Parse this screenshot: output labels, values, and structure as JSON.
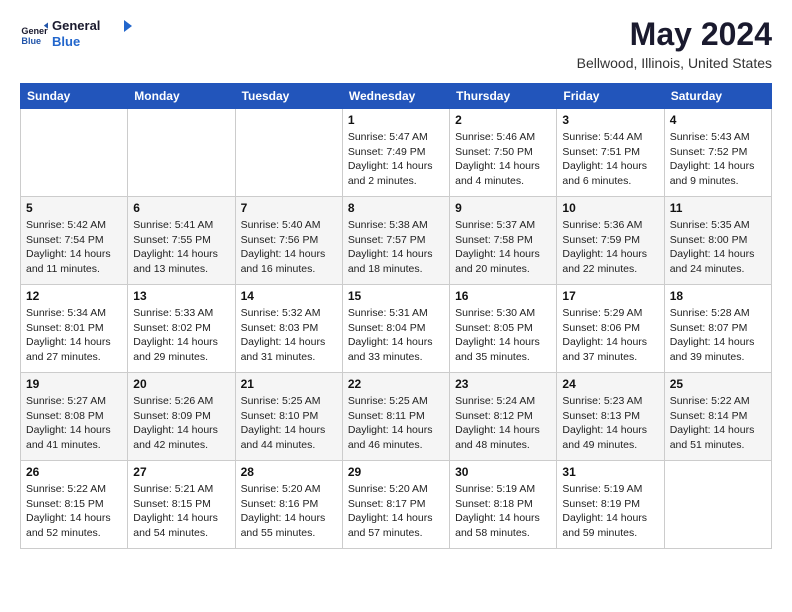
{
  "header": {
    "logo": {
      "line1": "General",
      "line2": "Blue"
    },
    "title": "May 2024",
    "subtitle": "Bellwood, Illinois, United States"
  },
  "weekdays": [
    "Sunday",
    "Monday",
    "Tuesday",
    "Wednesday",
    "Thursday",
    "Friday",
    "Saturday"
  ],
  "weeks": [
    [
      null,
      null,
      null,
      {
        "day": "1",
        "sunrise": "Sunrise: 5:47 AM",
        "sunset": "Sunset: 7:49 PM",
        "daylight": "Daylight: 14 hours and 2 minutes."
      },
      {
        "day": "2",
        "sunrise": "Sunrise: 5:46 AM",
        "sunset": "Sunset: 7:50 PM",
        "daylight": "Daylight: 14 hours and 4 minutes."
      },
      {
        "day": "3",
        "sunrise": "Sunrise: 5:44 AM",
        "sunset": "Sunset: 7:51 PM",
        "daylight": "Daylight: 14 hours and 6 minutes."
      },
      {
        "day": "4",
        "sunrise": "Sunrise: 5:43 AM",
        "sunset": "Sunset: 7:52 PM",
        "daylight": "Daylight: 14 hours and 9 minutes."
      }
    ],
    [
      {
        "day": "5",
        "sunrise": "Sunrise: 5:42 AM",
        "sunset": "Sunset: 7:54 PM",
        "daylight": "Daylight: 14 hours and 11 minutes."
      },
      {
        "day": "6",
        "sunrise": "Sunrise: 5:41 AM",
        "sunset": "Sunset: 7:55 PM",
        "daylight": "Daylight: 14 hours and 13 minutes."
      },
      {
        "day": "7",
        "sunrise": "Sunrise: 5:40 AM",
        "sunset": "Sunset: 7:56 PM",
        "daylight": "Daylight: 14 hours and 16 minutes."
      },
      {
        "day": "8",
        "sunrise": "Sunrise: 5:38 AM",
        "sunset": "Sunset: 7:57 PM",
        "daylight": "Daylight: 14 hours and 18 minutes."
      },
      {
        "day": "9",
        "sunrise": "Sunrise: 5:37 AM",
        "sunset": "Sunset: 7:58 PM",
        "daylight": "Daylight: 14 hours and 20 minutes."
      },
      {
        "day": "10",
        "sunrise": "Sunrise: 5:36 AM",
        "sunset": "Sunset: 7:59 PM",
        "daylight": "Daylight: 14 hours and 22 minutes."
      },
      {
        "day": "11",
        "sunrise": "Sunrise: 5:35 AM",
        "sunset": "Sunset: 8:00 PM",
        "daylight": "Daylight: 14 hours and 24 minutes."
      }
    ],
    [
      {
        "day": "12",
        "sunrise": "Sunrise: 5:34 AM",
        "sunset": "Sunset: 8:01 PM",
        "daylight": "Daylight: 14 hours and 27 minutes."
      },
      {
        "day": "13",
        "sunrise": "Sunrise: 5:33 AM",
        "sunset": "Sunset: 8:02 PM",
        "daylight": "Daylight: 14 hours and 29 minutes."
      },
      {
        "day": "14",
        "sunrise": "Sunrise: 5:32 AM",
        "sunset": "Sunset: 8:03 PM",
        "daylight": "Daylight: 14 hours and 31 minutes."
      },
      {
        "day": "15",
        "sunrise": "Sunrise: 5:31 AM",
        "sunset": "Sunset: 8:04 PM",
        "daylight": "Daylight: 14 hours and 33 minutes."
      },
      {
        "day": "16",
        "sunrise": "Sunrise: 5:30 AM",
        "sunset": "Sunset: 8:05 PM",
        "daylight": "Daylight: 14 hours and 35 minutes."
      },
      {
        "day": "17",
        "sunrise": "Sunrise: 5:29 AM",
        "sunset": "Sunset: 8:06 PM",
        "daylight": "Daylight: 14 hours and 37 minutes."
      },
      {
        "day": "18",
        "sunrise": "Sunrise: 5:28 AM",
        "sunset": "Sunset: 8:07 PM",
        "daylight": "Daylight: 14 hours and 39 minutes."
      }
    ],
    [
      {
        "day": "19",
        "sunrise": "Sunrise: 5:27 AM",
        "sunset": "Sunset: 8:08 PM",
        "daylight": "Daylight: 14 hours and 41 minutes."
      },
      {
        "day": "20",
        "sunrise": "Sunrise: 5:26 AM",
        "sunset": "Sunset: 8:09 PM",
        "daylight": "Daylight: 14 hours and 42 minutes."
      },
      {
        "day": "21",
        "sunrise": "Sunrise: 5:25 AM",
        "sunset": "Sunset: 8:10 PM",
        "daylight": "Daylight: 14 hours and 44 minutes."
      },
      {
        "day": "22",
        "sunrise": "Sunrise: 5:25 AM",
        "sunset": "Sunset: 8:11 PM",
        "daylight": "Daylight: 14 hours and 46 minutes."
      },
      {
        "day": "23",
        "sunrise": "Sunrise: 5:24 AM",
        "sunset": "Sunset: 8:12 PM",
        "daylight": "Daylight: 14 hours and 48 minutes."
      },
      {
        "day": "24",
        "sunrise": "Sunrise: 5:23 AM",
        "sunset": "Sunset: 8:13 PM",
        "daylight": "Daylight: 14 hours and 49 minutes."
      },
      {
        "day": "25",
        "sunrise": "Sunrise: 5:22 AM",
        "sunset": "Sunset: 8:14 PM",
        "daylight": "Daylight: 14 hours and 51 minutes."
      }
    ],
    [
      {
        "day": "26",
        "sunrise": "Sunrise: 5:22 AM",
        "sunset": "Sunset: 8:15 PM",
        "daylight": "Daylight: 14 hours and 52 minutes."
      },
      {
        "day": "27",
        "sunrise": "Sunrise: 5:21 AM",
        "sunset": "Sunset: 8:15 PM",
        "daylight": "Daylight: 14 hours and 54 minutes."
      },
      {
        "day": "28",
        "sunrise": "Sunrise: 5:20 AM",
        "sunset": "Sunset: 8:16 PM",
        "daylight": "Daylight: 14 hours and 55 minutes."
      },
      {
        "day": "29",
        "sunrise": "Sunrise: 5:20 AM",
        "sunset": "Sunset: 8:17 PM",
        "daylight": "Daylight: 14 hours and 57 minutes."
      },
      {
        "day": "30",
        "sunrise": "Sunrise: 5:19 AM",
        "sunset": "Sunset: 8:18 PM",
        "daylight": "Daylight: 14 hours and 58 minutes."
      },
      {
        "day": "31",
        "sunrise": "Sunrise: 5:19 AM",
        "sunset": "Sunset: 8:19 PM",
        "daylight": "Daylight: 14 hours and 59 minutes."
      },
      null
    ]
  ]
}
